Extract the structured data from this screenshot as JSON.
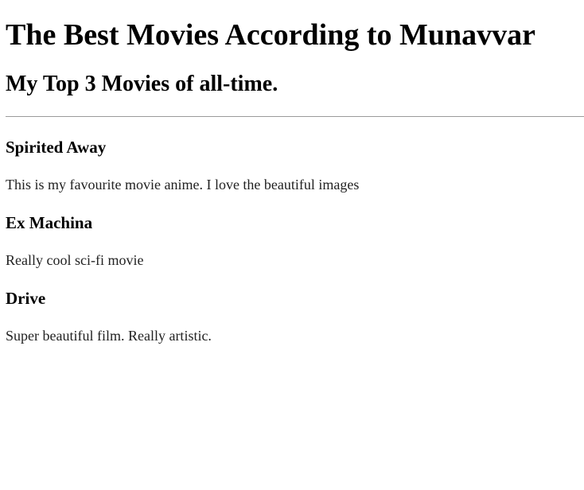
{
  "page": {
    "title": "The Best Movies According to Munavvar",
    "subtitle": "My Top 3 Movies of all-time."
  },
  "movies": [
    {
      "title": "Spirited Away",
      "description": "This is my favourite movie anime. I love the beautiful images"
    },
    {
      "title": "Ex Machina",
      "description": "Really cool sci-fi movie"
    },
    {
      "title": "Drive",
      "description": "Super beautiful film. Really artistic."
    }
  ]
}
